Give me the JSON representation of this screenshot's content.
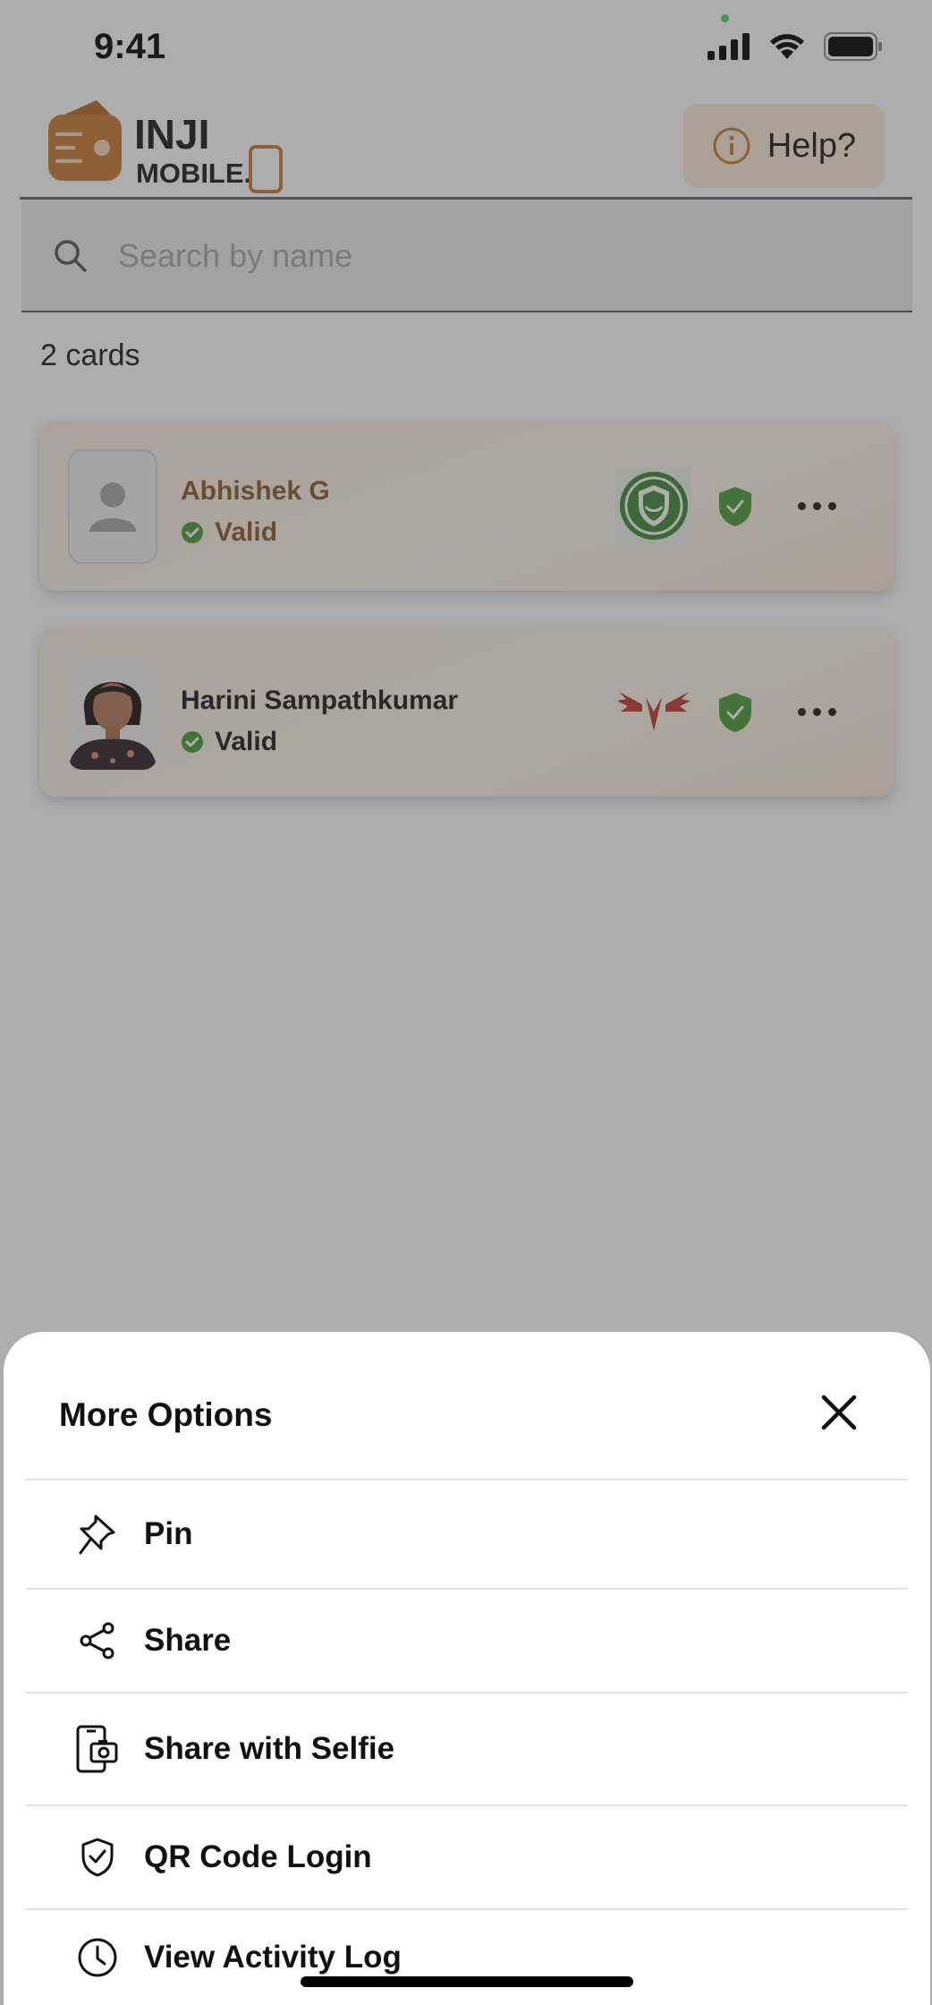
{
  "status_bar": {
    "time": "9:41"
  },
  "header": {
    "logo_text_line1": "INJI",
    "logo_text_line2": "MOBILE.",
    "help_label": "Help?"
  },
  "search": {
    "placeholder": "Search by name"
  },
  "card_count": "2 cards",
  "cards": [
    {
      "name": "Abhishek G",
      "status": "Valid",
      "issuer_logo": "green-shield-hands-logo",
      "has_photo": false
    },
    {
      "name": "Harini Sampathkumar",
      "status": "Valid",
      "issuer_logo": "red-wings-logo",
      "has_photo": true
    }
  ],
  "sheet": {
    "title": "More Options",
    "items": [
      {
        "label": "Pin",
        "icon": "pin-icon"
      },
      {
        "label": "Share",
        "icon": "share-icon"
      },
      {
        "label": "Share with Selfie",
        "icon": "share-with-selfie-icon"
      },
      {
        "label": "QR Code Login",
        "icon": "shield-check-icon"
      },
      {
        "label": "View Activity Log",
        "icon": "clock-icon"
      }
    ]
  },
  "colors": {
    "brand_orange": "#c87a35",
    "valid_green": "#4a9b3a",
    "help_bg": "#fdebd9"
  }
}
